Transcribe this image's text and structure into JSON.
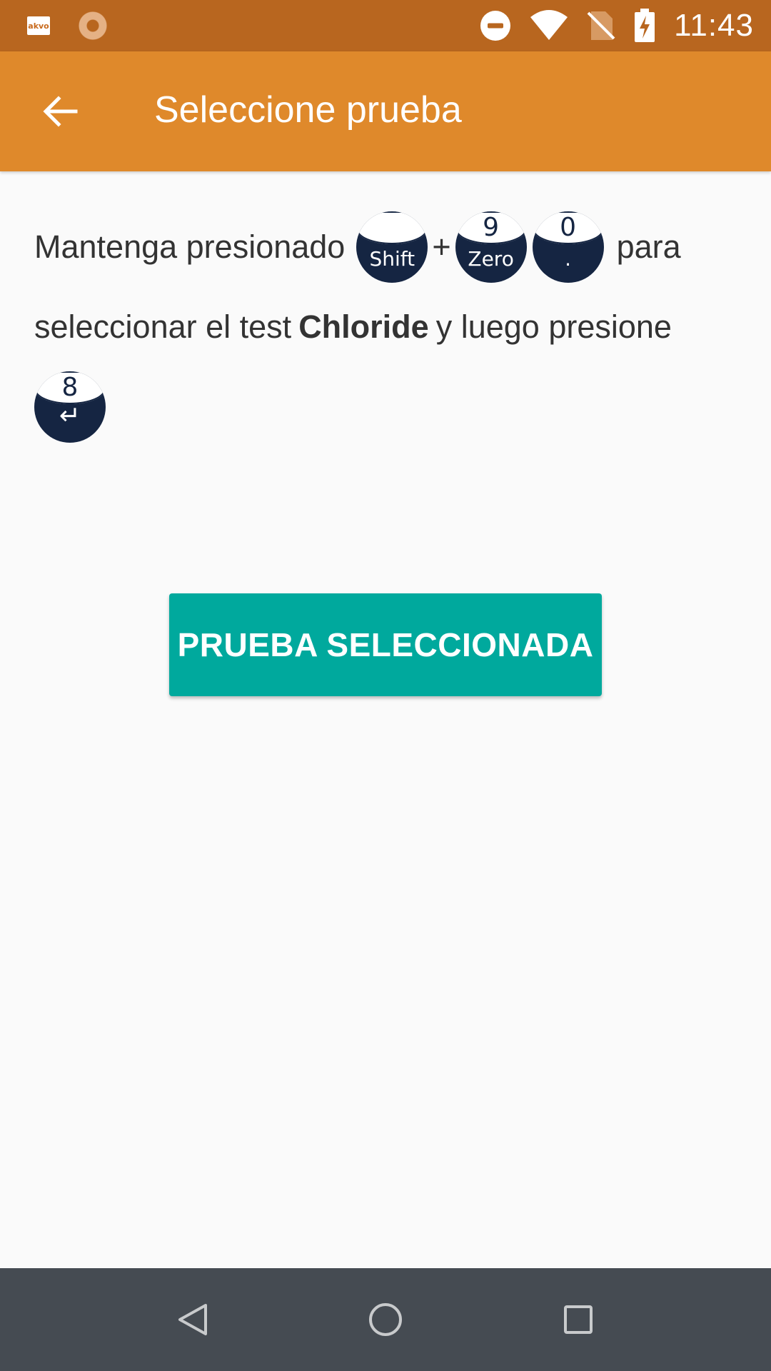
{
  "status_bar": {
    "time": "11:43",
    "left_icons": [
      "akvo-app-icon",
      "loading-spinner-icon"
    ],
    "akvo_icon_text": "akvo",
    "right_icons": [
      "do-not-disturb-icon",
      "wifi-icon",
      "no-sim-icon",
      "battery-charging-icon"
    ]
  },
  "app_bar": {
    "title": "Seleccione prueba",
    "back_icon": "arrow-back-icon",
    "color": "#df892b"
  },
  "instructions": {
    "part1": "Mantenga presionado",
    "plus": "+",
    "part2": "para",
    "part3": "seleccionar el test",
    "test_name": "Chloride",
    "part4": "y luego presione",
    "keys": {
      "shift": {
        "top": "",
        "bottom": "Shift"
      },
      "nine": {
        "top": "9",
        "bottom": "Zero"
      },
      "zero": {
        "top": "0",
        "bottom": "."
      },
      "eight": {
        "top": "8",
        "bottom": "↵"
      }
    }
  },
  "actions": {
    "selected_button_label": "PRUEBA SELECCIONADA",
    "button_color": "#00a99d"
  },
  "nav_bar": {
    "items": [
      "back-triangle-icon",
      "home-circle-icon",
      "recents-square-icon"
    ]
  }
}
